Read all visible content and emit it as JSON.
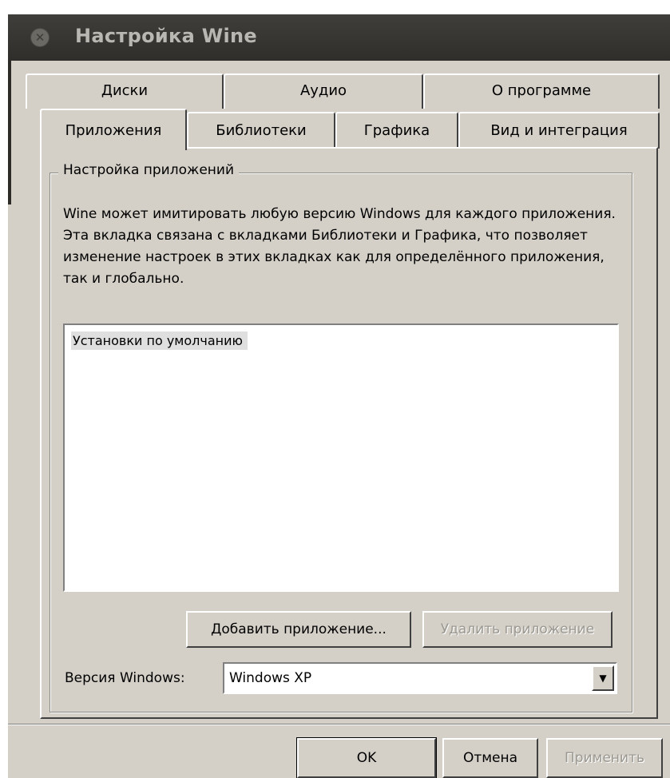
{
  "window": {
    "title": "Настройка Wine",
    "close_glyph": "✕"
  },
  "tabs": {
    "row1": [
      "Диски",
      "Аудио",
      "О программе"
    ],
    "row2": [
      "Приложения",
      "Библиотеки",
      "Графика",
      "Вид и интеграция"
    ],
    "active": "Приложения"
  },
  "apps_panel": {
    "group_title": "Настройка приложений",
    "description": "Wine может имитировать любую версию Windows для каждого приложения. Эта вкладка связана с вкладками Библиотеки и Графика, что позволяет изменение настроек в этих вкладках как для определённого приложения, так и глобально.",
    "list_items": [
      "Установки по умолчанию"
    ],
    "add_button": "Добавить приложение...",
    "remove_button": "Удалить приложение",
    "version_label": "Версия Windows:",
    "version_value": "Windows XP"
  },
  "footer": {
    "ok": "OK",
    "cancel": "Отмена",
    "apply": "Применить"
  },
  "icons": {
    "dropdown": "chevron-down-icon",
    "close": "close-icon"
  }
}
